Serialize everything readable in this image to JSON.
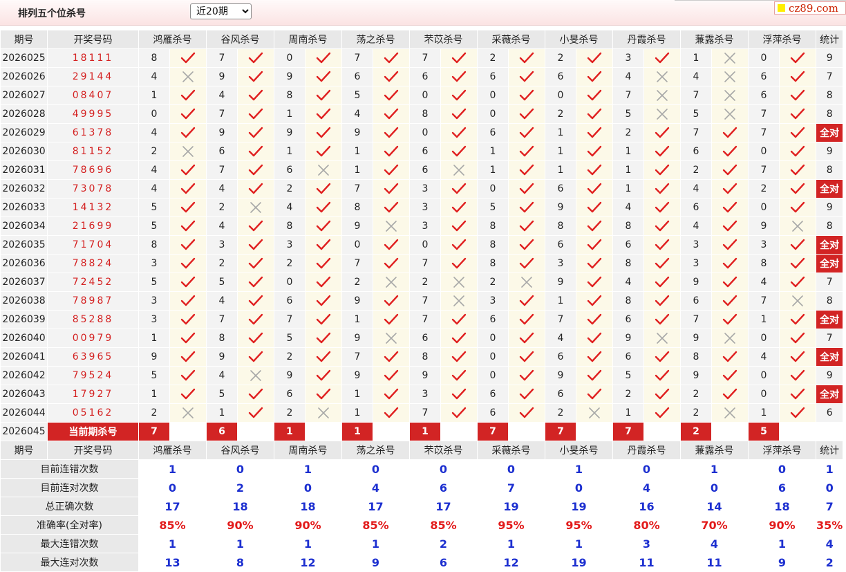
{
  "header": {
    "title": "排列五个位杀号",
    "period_selected": "近20期",
    "period_options": [
      "近20期"
    ],
    "logo_text": "cz89.com"
  },
  "columns": {
    "issue": "期号",
    "draw": "开奖号码",
    "experts": [
      "鸿雁杀号",
      "谷风杀号",
      "周南杀号",
      "荡之杀号",
      "芣苡杀号",
      "采薇杀号",
      "小旻杀号",
      "丹霞杀号",
      "蒹露杀号",
      "浮萍杀号"
    ],
    "count": "统计"
  },
  "rows": [
    {
      "issue": "2026025",
      "draw": "18111",
      "kills": [
        8,
        7,
        0,
        7,
        7,
        2,
        2,
        3,
        1,
        0
      ],
      "hits": [
        1,
        1,
        1,
        1,
        1,
        1,
        1,
        1,
        0,
        1
      ],
      "count": "9"
    },
    {
      "issue": "2026026",
      "draw": "29144",
      "kills": [
        4,
        9,
        9,
        6,
        6,
        6,
        6,
        4,
        4,
        6
      ],
      "hits": [
        0,
        1,
        1,
        1,
        1,
        1,
        1,
        0,
        0,
        1
      ],
      "count": "7"
    },
    {
      "issue": "2026027",
      "draw": "08407",
      "kills": [
        1,
        4,
        8,
        5,
        0,
        0,
        0,
        7,
        7,
        6
      ],
      "hits": [
        1,
        1,
        1,
        1,
        1,
        1,
        1,
        0,
        0,
        1
      ],
      "count": "8"
    },
    {
      "issue": "2026028",
      "draw": "49995",
      "kills": [
        0,
        7,
        1,
        4,
        8,
        0,
        2,
        5,
        5,
        7
      ],
      "hits": [
        1,
        1,
        1,
        1,
        1,
        1,
        1,
        0,
        0,
        1
      ],
      "count": "8"
    },
    {
      "issue": "2026029",
      "draw": "61378",
      "kills": [
        4,
        9,
        9,
        9,
        0,
        6,
        1,
        2,
        7,
        7
      ],
      "hits": [
        1,
        1,
        1,
        1,
        1,
        1,
        1,
        1,
        1,
        1
      ],
      "count": "全对"
    },
    {
      "issue": "2026030",
      "draw": "81152",
      "kills": [
        2,
        6,
        1,
        1,
        6,
        1,
        1,
        1,
        6,
        0
      ],
      "hits": [
        0,
        1,
        1,
        1,
        1,
        1,
        1,
        1,
        1,
        1
      ],
      "count": "9"
    },
    {
      "issue": "2026031",
      "draw": "78696",
      "kills": [
        4,
        7,
        6,
        1,
        6,
        1,
        1,
        1,
        2,
        7
      ],
      "hits": [
        1,
        1,
        0,
        1,
        0,
        1,
        1,
        1,
        1,
        1
      ],
      "count": "8"
    },
    {
      "issue": "2026032",
      "draw": "73078",
      "kills": [
        4,
        4,
        2,
        7,
        3,
        0,
        6,
        1,
        4,
        2
      ],
      "hits": [
        1,
        1,
        1,
        1,
        1,
        1,
        1,
        1,
        1,
        1
      ],
      "count": "全对"
    },
    {
      "issue": "2026033",
      "draw": "14132",
      "kills": [
        5,
        2,
        4,
        8,
        3,
        5,
        9,
        4,
        6,
        0
      ],
      "hits": [
        1,
        0,
        1,
        1,
        1,
        1,
        1,
        1,
        1,
        1
      ],
      "count": "9"
    },
    {
      "issue": "2026034",
      "draw": "21699",
      "kills": [
        5,
        4,
        8,
        9,
        3,
        8,
        8,
        8,
        4,
        9
      ],
      "hits": [
        1,
        1,
        1,
        0,
        1,
        1,
        1,
        1,
        1,
        0
      ],
      "count": "8"
    },
    {
      "issue": "2026035",
      "draw": "71704",
      "kills": [
        8,
        3,
        3,
        0,
        0,
        8,
        6,
        6,
        3,
        3
      ],
      "hits": [
        1,
        1,
        1,
        1,
        1,
        1,
        1,
        1,
        1,
        1
      ],
      "count": "全对"
    },
    {
      "issue": "2026036",
      "draw": "78824",
      "kills": [
        3,
        2,
        2,
        7,
        7,
        8,
        3,
        8,
        3,
        8
      ],
      "hits": [
        1,
        1,
        1,
        1,
        1,
        1,
        1,
        1,
        1,
        1
      ],
      "count": "全对"
    },
    {
      "issue": "2026037",
      "draw": "72452",
      "kills": [
        5,
        5,
        0,
        2,
        2,
        2,
        9,
        4,
        9,
        4
      ],
      "hits": [
        1,
        1,
        1,
        0,
        0,
        0,
        1,
        1,
        1,
        1
      ],
      "count": "7"
    },
    {
      "issue": "2026038",
      "draw": "78987",
      "kills": [
        3,
        4,
        6,
        9,
        7,
        3,
        1,
        8,
        6,
        7
      ],
      "hits": [
        1,
        1,
        1,
        1,
        0,
        1,
        1,
        1,
        1,
        0
      ],
      "count": "8"
    },
    {
      "issue": "2026039",
      "draw": "85288",
      "kills": [
        3,
        7,
        7,
        1,
        7,
        6,
        7,
        6,
        7,
        1
      ],
      "hits": [
        1,
        1,
        1,
        1,
        1,
        1,
        1,
        1,
        1,
        1
      ],
      "count": "全对"
    },
    {
      "issue": "2026040",
      "draw": "00979",
      "kills": [
        1,
        8,
        5,
        9,
        6,
        0,
        4,
        9,
        9,
        0
      ],
      "hits": [
        1,
        1,
        1,
        0,
        1,
        1,
        1,
        0,
        0,
        1
      ],
      "count": "7"
    },
    {
      "issue": "2026041",
      "draw": "63965",
      "kills": [
        9,
        9,
        2,
        7,
        8,
        0,
        6,
        6,
        8,
        4
      ],
      "hits": [
        1,
        1,
        1,
        1,
        1,
        1,
        1,
        1,
        1,
        1
      ],
      "count": "全对"
    },
    {
      "issue": "2026042",
      "draw": "79524",
      "kills": [
        5,
        4,
        9,
        9,
        9,
        0,
        9,
        5,
        9,
        0
      ],
      "hits": [
        1,
        0,
        1,
        1,
        1,
        1,
        1,
        1,
        1,
        1
      ],
      "count": "9"
    },
    {
      "issue": "2026043",
      "draw": "17927",
      "kills": [
        1,
        5,
        6,
        1,
        3,
        6,
        6,
        2,
        2,
        0
      ],
      "hits": [
        1,
        1,
        1,
        1,
        1,
        1,
        1,
        1,
        1,
        1
      ],
      "count": "全对"
    },
    {
      "issue": "2026044",
      "draw": "05162",
      "kills": [
        2,
        1,
        2,
        1,
        7,
        6,
        2,
        1,
        2,
        1
      ],
      "hits": [
        0,
        1,
        0,
        1,
        1,
        1,
        0,
        1,
        0,
        1
      ],
      "count": "6"
    }
  ],
  "current": {
    "issue": "2026045",
    "label": "当前期杀号",
    "kills": [
      7,
      6,
      1,
      1,
      1,
      7,
      7,
      7,
      2,
      5
    ]
  },
  "footer_header": {
    "issue": "期号",
    "draw": "开奖号码",
    "count": "统计"
  },
  "stats": [
    {
      "label": "目前连错次数",
      "values": [
        "1",
        "0",
        "1",
        "0",
        "0",
        "0",
        "1",
        "0",
        "1",
        "0"
      ],
      "total": "1",
      "kind": "num"
    },
    {
      "label": "目前连对次数",
      "values": [
        "0",
        "2",
        "0",
        "4",
        "6",
        "7",
        "0",
        "4",
        "0",
        "6"
      ],
      "total": "0",
      "kind": "num"
    },
    {
      "label": "总正确次数",
      "values": [
        "17",
        "18",
        "18",
        "17",
        "17",
        "19",
        "19",
        "16",
        "14",
        "18"
      ],
      "total": "7",
      "kind": "num"
    },
    {
      "label": "准确率(全对率)",
      "values": [
        "85%",
        "90%",
        "90%",
        "85%",
        "85%",
        "95%",
        "95%",
        "80%",
        "70%",
        "90%"
      ],
      "total": "35%",
      "kind": "pct"
    },
    {
      "label": "最大连错次数",
      "values": [
        "1",
        "1",
        "1",
        "1",
        "2",
        "1",
        "1",
        "3",
        "4",
        "1"
      ],
      "total": "4",
      "kind": "num"
    },
    {
      "label": "最大连对次数",
      "values": [
        "13",
        "8",
        "12",
        "9",
        "6",
        "12",
        "19",
        "11",
        "11",
        "9"
      ],
      "total": "2",
      "kind": "num"
    }
  ],
  "colors": {
    "accent_red": "#d22424",
    "stat_blue": "#1c2fd0",
    "check_red": "#e02020",
    "cross_gray": "#a8a8a8"
  }
}
